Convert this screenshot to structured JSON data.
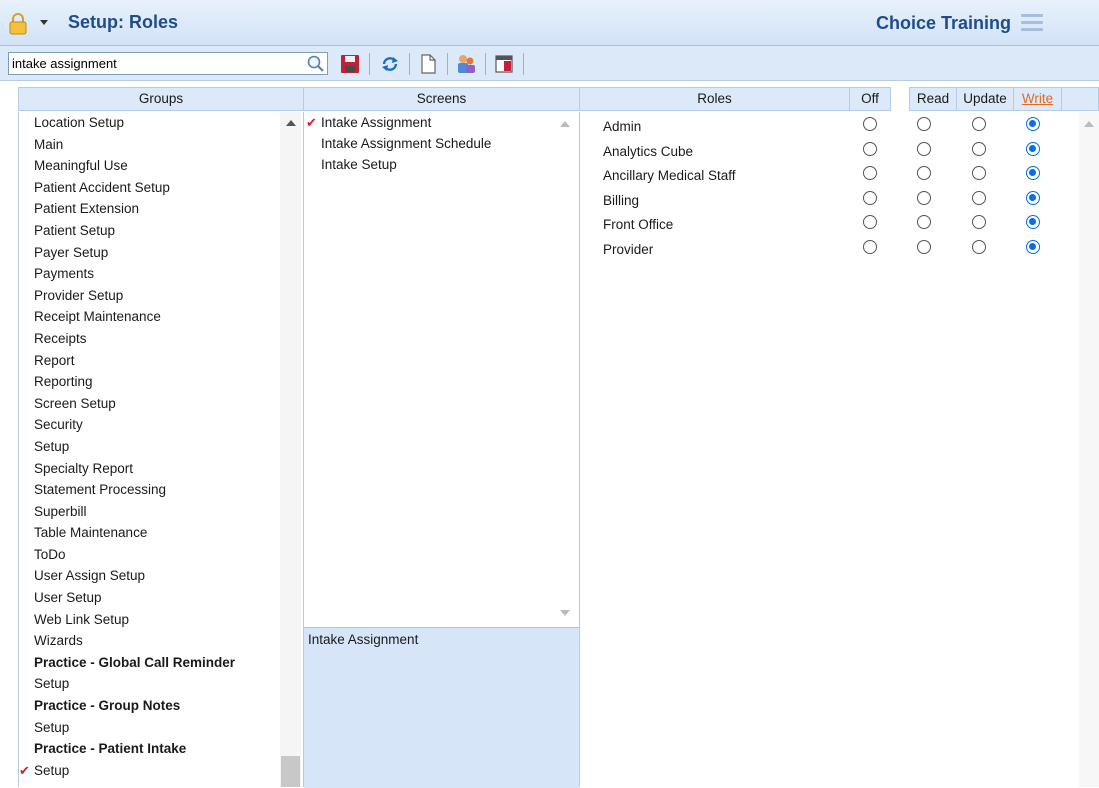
{
  "title_bar": {
    "title": "Setup: Roles",
    "brand": "Choice Training",
    "icons": [
      "lock-icon",
      "caret-down-icon",
      "hamburger-menu-icon"
    ]
  },
  "toolbar": {
    "search_value": "intake assignment",
    "buttons": [
      "search-icon",
      "save-icon",
      "refresh-icon",
      "new-document-icon",
      "user-roles-icon",
      "grid-layout-icon"
    ]
  },
  "columns": {
    "groups": "Groups",
    "screens": "Screens",
    "roles": "Roles",
    "off": "Off",
    "read": "Read",
    "update": "Update",
    "write": "Write"
  },
  "groups": [
    {
      "label": "Location Setup",
      "bold": false,
      "checked": false
    },
    {
      "label": "Main",
      "bold": false,
      "checked": false
    },
    {
      "label": "Meaningful Use",
      "bold": false,
      "checked": false
    },
    {
      "label": "Patient Accident Setup",
      "bold": false,
      "checked": false
    },
    {
      "label": "Patient Extension",
      "bold": false,
      "checked": false
    },
    {
      "label": "Patient Setup",
      "bold": false,
      "checked": false
    },
    {
      "label": "Payer Setup",
      "bold": false,
      "checked": false
    },
    {
      "label": "Payments",
      "bold": false,
      "checked": false
    },
    {
      "label": "Provider Setup",
      "bold": false,
      "checked": false
    },
    {
      "label": "Receipt Maintenance",
      "bold": false,
      "checked": false
    },
    {
      "label": "Receipts",
      "bold": false,
      "checked": false
    },
    {
      "label": "Report",
      "bold": false,
      "checked": false
    },
    {
      "label": "Reporting",
      "bold": false,
      "checked": false
    },
    {
      "label": "Screen Setup",
      "bold": false,
      "checked": false
    },
    {
      "label": "Security",
      "bold": false,
      "checked": false
    },
    {
      "label": "Setup",
      "bold": false,
      "checked": false
    },
    {
      "label": "Specialty Report",
      "bold": false,
      "checked": false
    },
    {
      "label": "Statement Processing",
      "bold": false,
      "checked": false
    },
    {
      "label": "Superbill",
      "bold": false,
      "checked": false
    },
    {
      "label": "Table Maintenance",
      "bold": false,
      "checked": false
    },
    {
      "label": "ToDo",
      "bold": false,
      "checked": false
    },
    {
      "label": "User Assign Setup",
      "bold": false,
      "checked": false
    },
    {
      "label": "User Setup",
      "bold": false,
      "checked": false
    },
    {
      "label": "Web Link Setup",
      "bold": false,
      "checked": false
    },
    {
      "label": "Wizards",
      "bold": false,
      "checked": false
    },
    {
      "label": "Practice - Global Call Reminder",
      "bold": true,
      "checked": false
    },
    {
      "label": "Setup",
      "bold": false,
      "checked": false
    },
    {
      "label": "Practice - Group Notes",
      "bold": true,
      "checked": false
    },
    {
      "label": "Setup",
      "bold": false,
      "checked": false
    },
    {
      "label": "Practice - Patient Intake",
      "bold": true,
      "checked": false
    },
    {
      "label": "Setup",
      "bold": false,
      "checked": true
    }
  ],
  "screens": [
    {
      "label": "Intake Assignment",
      "checked": true
    },
    {
      "label": "Intake Assignment Schedule",
      "checked": false
    },
    {
      "label": "Intake Setup",
      "checked": false
    }
  ],
  "detail": {
    "title": "Intake Assignment"
  },
  "roles": [
    {
      "name": "Admin",
      "permission": "Write"
    },
    {
      "name": "Analytics Cube",
      "permission": "Write"
    },
    {
      "name": "Ancillary Medical Staff",
      "permission": "Write"
    },
    {
      "name": "Billing",
      "permission": "Write"
    },
    {
      "name": "Front Office",
      "permission": "Write"
    },
    {
      "name": "Provider",
      "permission": "Write"
    }
  ],
  "colors": {
    "accent_blue": "#1f4d8c",
    "radio_selected": "#0a6ce6",
    "check_red": "#d0202b",
    "write_link": "#e06b1f",
    "panel_header_bg": "#dce9f8"
  }
}
